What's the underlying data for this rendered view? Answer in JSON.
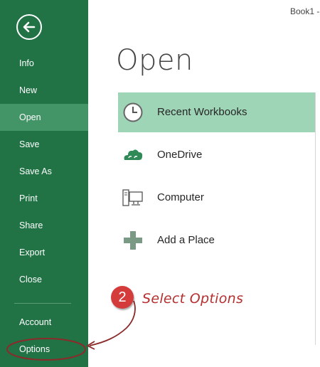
{
  "window": {
    "title": "Book1 -"
  },
  "sidebar": {
    "back_icon": "back-arrow-icon",
    "items": [
      {
        "label": "Info"
      },
      {
        "label": "New"
      },
      {
        "label": "Open",
        "active": true
      },
      {
        "label": "Save"
      },
      {
        "label": "Save As"
      },
      {
        "label": "Print"
      },
      {
        "label": "Share"
      },
      {
        "label": "Export"
      },
      {
        "label": "Close"
      },
      {
        "label": "Account"
      },
      {
        "label": "Options"
      }
    ]
  },
  "main": {
    "title": "Open",
    "locations": [
      {
        "label": "Recent Workbooks",
        "icon": "clock-icon",
        "active": true
      },
      {
        "label": "OneDrive",
        "icon": "cloud-icon"
      },
      {
        "label": "Computer",
        "icon": "computer-icon"
      },
      {
        "label": "Add a Place",
        "icon": "plus-icon"
      }
    ]
  },
  "annotation": {
    "step": "2",
    "text": "Select Options",
    "color": "#b52f2f"
  },
  "colors": {
    "sidebar": "#217346",
    "sidebar_active": "#439467",
    "location_active": "#9fd5b7"
  }
}
